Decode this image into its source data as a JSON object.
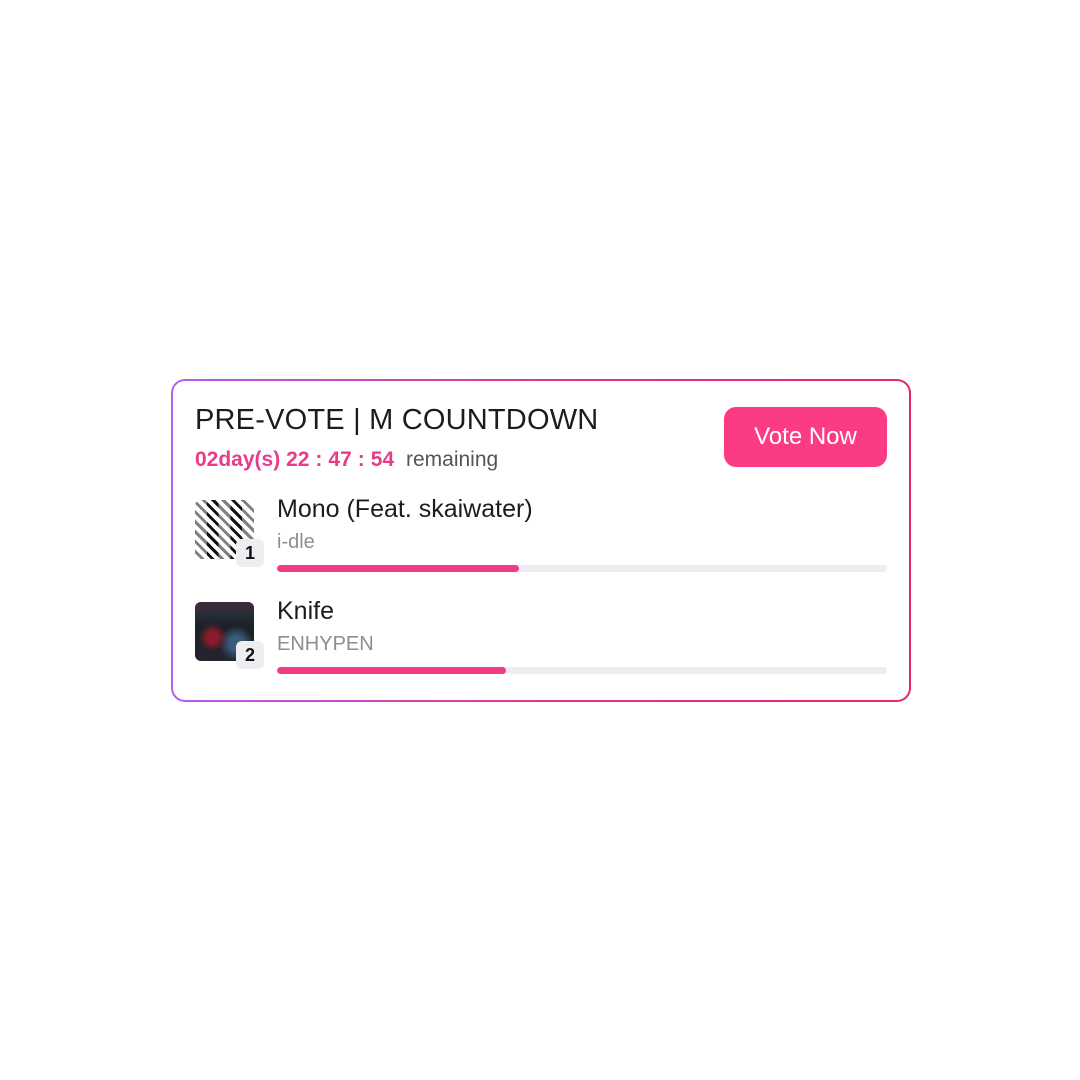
{
  "header": {
    "title": "PRE-VOTE | M COUNTDOWN",
    "countdown": {
      "days": "02day(s)",
      "hours": "22",
      "minutes": "47",
      "seconds": "54",
      "separator": ":",
      "suffix": "remaining"
    },
    "vote_button": "Vote Now"
  },
  "entries": [
    {
      "rank": "1",
      "song": "Mono (Feat. skaiwater)",
      "artist": "i-dle",
      "progress": 0.397,
      "icon": "album-cover-mono-icon"
    },
    {
      "rank": "2",
      "song": "Knife",
      "artist": "ENHYPEN",
      "progress": 0.375,
      "icon": "album-cover-knife-icon"
    }
  ],
  "colors": {
    "accent": "#fb3b84",
    "countdown": "#ea3b8a",
    "border_start": "#b65cf0",
    "border_end": "#e8246e",
    "track": "#eceef1"
  }
}
